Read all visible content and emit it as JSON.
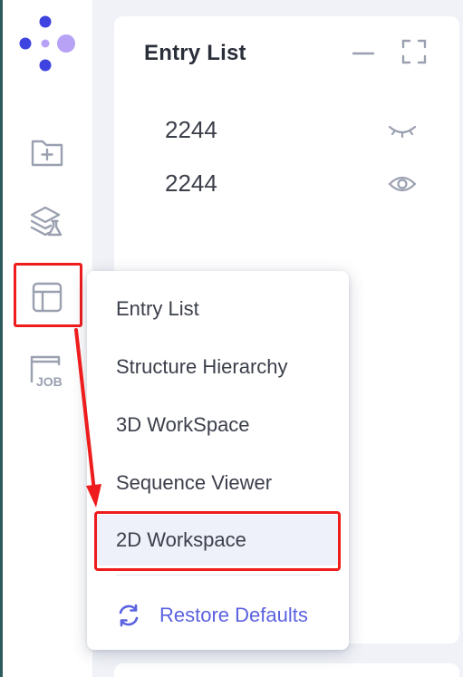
{
  "sidebar": {
    "logo_icon": "app-logo-dots",
    "items": [
      {
        "name": "new-folder",
        "icon": "folder-plus-icon"
      },
      {
        "name": "layers-lab",
        "icon": "layers-flask-icon"
      },
      {
        "name": "layout",
        "icon": "layout-panel-icon",
        "highlighted": true
      },
      {
        "name": "job",
        "icon": "job-icon",
        "label": "JOB"
      }
    ]
  },
  "panel": {
    "title": "Entry List",
    "entries": [
      {
        "label": "2244",
        "visibility": "hidden"
      },
      {
        "label": "2244",
        "visibility": "visible"
      }
    ]
  },
  "dropdown": {
    "items": [
      {
        "label": "Entry List"
      },
      {
        "label": "Structure Hierarchy"
      },
      {
        "label": "3D WorkSpace"
      },
      {
        "label": "Sequence Viewer"
      },
      {
        "label": "2D Workspace",
        "selected": true
      }
    ],
    "restore_label": "Restore Defaults"
  },
  "colors": {
    "accent": "#5b62e0",
    "highlight": "#ee1c1c",
    "logo_primary": "#3f44e0",
    "logo_secondary": "#b7a2f5",
    "icon_gray": "#9aa0b0"
  }
}
